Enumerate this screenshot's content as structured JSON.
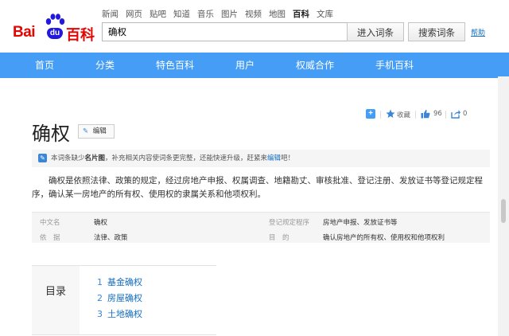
{
  "logo": {
    "bai": "Bai",
    "du": "du",
    "baike": "百科"
  },
  "topnav": [
    {
      "label": "新闻",
      "active": false
    },
    {
      "label": "网页",
      "active": false
    },
    {
      "label": "贴吧",
      "active": false
    },
    {
      "label": "知道",
      "active": false
    },
    {
      "label": "音乐",
      "active": false
    },
    {
      "label": "图片",
      "active": false
    },
    {
      "label": "视频",
      "active": false
    },
    {
      "label": "地图",
      "active": false
    },
    {
      "label": "百科",
      "active": true
    },
    {
      "label": "文库",
      "active": false
    }
  ],
  "search": {
    "value": "确权",
    "enter_label": "进入词条",
    "search_label": "搜索词条",
    "help": "帮助"
  },
  "mainnav": [
    "首页",
    "分类",
    "特色百科",
    "用户",
    "权威合作",
    "手机百科"
  ],
  "tools": {
    "collect": "收藏",
    "likes": "96",
    "shares": "0"
  },
  "entry": {
    "title": "确权",
    "edit_label": "编辑"
  },
  "notice": {
    "pre": "本词条缺少",
    "bold": "名片图",
    "mid": "，补充相关内容使词条更完整，还能快速升级，赶紧来",
    "link": "编辑",
    "post": "吧！"
  },
  "summary": "确权是依照法律、政策的规定，经过房地产申报、权属调查、地籍勘丈、审核批准、登记注册、发放证书等登记规定程序，确认某一房地产的所有权、使用权的隶属关系和他项权利。",
  "basic_info": [
    {
      "label": "中文名",
      "value": "确权"
    },
    {
      "label": "依　据",
      "value": "法律、政策"
    },
    {
      "label": "登记规定程序",
      "value": "房地产申报、发放证书等"
    },
    {
      "label": "目　的",
      "value": "确认房地产的所有权、使用权和他项权利"
    }
  ],
  "toc": {
    "title": "目录",
    "items": [
      {
        "num": "1",
        "label": "基金确权"
      },
      {
        "num": "2",
        "label": "房屋确权"
      },
      {
        "num": "3",
        "label": "土地确权"
      }
    ]
  },
  "colors": {
    "nav_blue": "#459df5",
    "logo_red": "#e10602",
    "logo_blue": "#2319dc",
    "link_blue": "#136ec2"
  }
}
